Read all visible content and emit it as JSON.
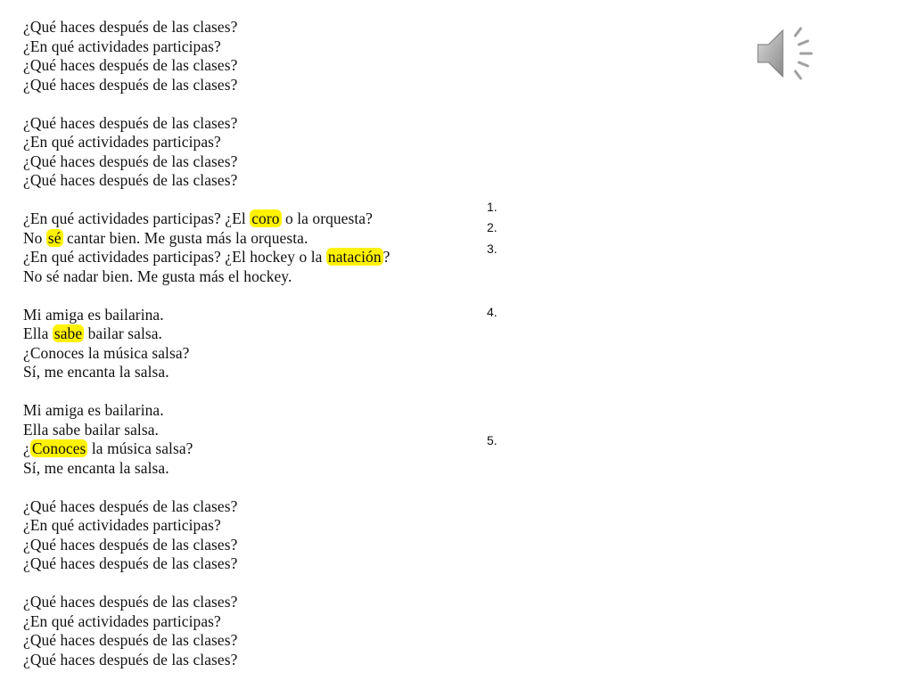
{
  "stanzas": [
    {
      "lines": [
        [
          {
            "t": "¿Qué haces después de las clases?"
          }
        ],
        [
          {
            "t": "¿En qué actividades participas?"
          }
        ],
        [
          {
            "t": "¿Qué haces después de las clases?"
          }
        ],
        [
          {
            "t": "¿Qué haces después de las clases?"
          }
        ]
      ]
    },
    {
      "lines": [
        [
          {
            "t": "¿Qué haces después de las clases?"
          }
        ],
        [
          {
            "t": "¿En qué actividades participas?"
          }
        ],
        [
          {
            "t": "¿Qué haces después de las clases?"
          }
        ],
        [
          {
            "t": "¿Qué haces después de las clases?"
          }
        ]
      ]
    },
    {
      "lines": [
        [
          {
            "t": "¿En qué actividades participas? ¿El "
          },
          {
            "t": "coro",
            "h": true
          },
          {
            "t": " o la orquesta?"
          }
        ],
        [
          {
            "t": "No "
          },
          {
            "t": "sé",
            "h": true
          },
          {
            "t": " cantar bien. Me gusta más la orquesta."
          }
        ],
        [
          {
            "t": "¿En qué actividades participas? ¿El hockey o la "
          },
          {
            "t": "natación",
            "h": true
          },
          {
            "t": "?"
          }
        ],
        [
          {
            "t": "No sé nadar bien. Me gusta más el hockey."
          }
        ]
      ]
    },
    {
      "lines": [
        [
          {
            "t": "Mi amiga es bailarina."
          }
        ],
        [
          {
            "t": "Ella "
          },
          {
            "t": "sabe",
            "h": true
          },
          {
            "t": " bailar salsa."
          }
        ],
        [
          {
            "t": "¿Conoces la música salsa?"
          }
        ],
        [
          {
            "t": "Sí, me encanta la salsa."
          }
        ]
      ]
    },
    {
      "lines": [
        [
          {
            "t": "Mi amiga es bailarina."
          }
        ],
        [
          {
            "t": "Ella sabe bailar salsa."
          }
        ],
        [
          {
            "t": "¿"
          },
          {
            "t": "Conoces",
            "h": true
          },
          {
            "t": " la música salsa?"
          }
        ],
        [
          {
            "t": "Sí, me encanta la salsa."
          }
        ]
      ]
    },
    {
      "lines": [
        [
          {
            "t": "¿Qué haces después de las clases?"
          }
        ],
        [
          {
            "t": "¿En qué actividades participas?"
          }
        ],
        [
          {
            "t": "¿Qué haces después de las clases?"
          }
        ],
        [
          {
            "t": "¿Qué haces después de las clases?"
          }
        ]
      ]
    },
    {
      "lines": [
        [
          {
            "t": "¿Qué haces después de las clases?"
          }
        ],
        [
          {
            "t": "¿En qué actividades participas?"
          }
        ],
        [
          {
            "t": "¿Qué haces después de las clases?"
          }
        ],
        [
          {
            "t": "¿Qué haces después de las clases?"
          }
        ]
      ]
    }
  ],
  "numbered_list": [
    "1.",
    "2.",
    "3.",
    "4.",
    "5."
  ],
  "highlight_color": "#fff200",
  "audio_icon": "speaker-icon"
}
